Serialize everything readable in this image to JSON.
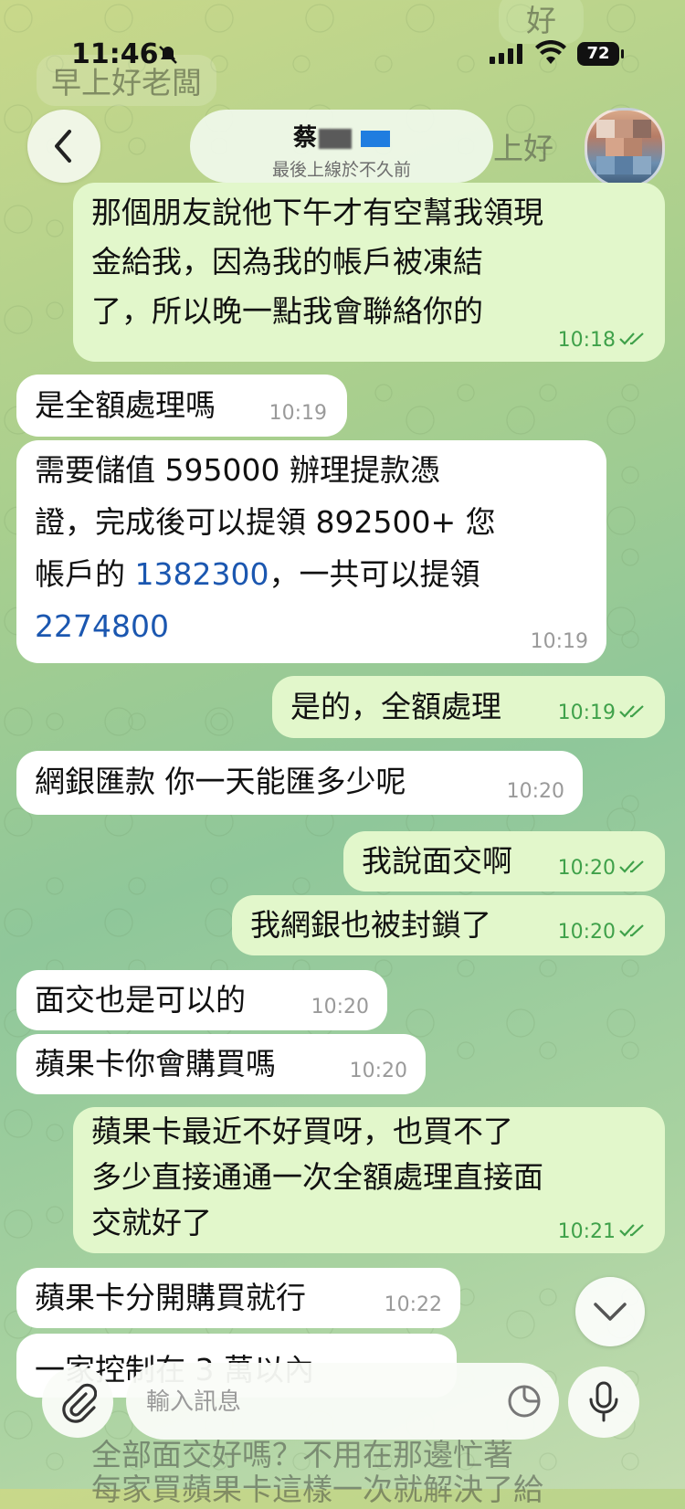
{
  "status": {
    "time": "11:46",
    "battery": "72"
  },
  "header": {
    "contact_name": "蔡",
    "status": "最後上線於不久前"
  },
  "messages": [
    {
      "dir": "out",
      "lines": "那個朋友說他下午才有空幫我領現\n金給我，因為我的帳戶被凍結\n了，所以晚一點我會聯絡你的",
      "time": "10:18"
    },
    {
      "dir": "in",
      "text": "是全額處理嗎",
      "time": "10:19"
    },
    {
      "dir": "in",
      "part1": "需要儲值 595000 辦理提款憑\n證，完成後可以提領 892500+ 您\n帳戶的 ",
      "link1": "1382300",
      "part2": "，一共可以提領\n",
      "link2": "2274800",
      "time": "10:19"
    },
    {
      "dir": "out",
      "text": "是的，全額處理",
      "time": "10:19"
    },
    {
      "dir": "in",
      "text": "網銀匯款 你一天能匯多少呢",
      "time": "10:20"
    },
    {
      "dir": "out",
      "text": "我說面交啊",
      "time": "10:20"
    },
    {
      "dir": "out",
      "text": "我網銀也被封鎖了",
      "time": "10:20"
    },
    {
      "dir": "in",
      "text": "面交也是可以的",
      "time": "10:20"
    },
    {
      "dir": "in",
      "text": "蘋果卡你會購買嗎",
      "time": "10:20"
    },
    {
      "dir": "out",
      "lines": "蘋果卡最近不好買呀，也買不了\n多少直接通通一次全額處理直接面\n交就好了",
      "time": "10:21"
    },
    {
      "dir": "in",
      "text": "蘋果卡分開購買就行",
      "time": "10:22"
    },
    {
      "dir": "in",
      "text": "一家控制在 3 萬以內",
      "time": ""
    }
  ],
  "bg_behind": {
    "top_left": "早上好老闆",
    "top_right": "好",
    "right": "上好"
  },
  "footer_faded": {
    "line1": "全部面交好嗎？不用在那邊忙著",
    "line2": "每家買蘋果卡這樣一次就解決了給"
  },
  "composer": {
    "placeholder": "輸入訊息"
  },
  "icons": {
    "back": "chevron-left-icon",
    "attach": "paperclip-icon",
    "sticker": "sticker-icon",
    "mic": "microphone-icon",
    "scroll": "chevron-down-icon"
  },
  "colors": {
    "bubble_out": "#e2f7cb",
    "bubble_in": "#ffffff",
    "link": "#1b57b0",
    "read_tick": "#3fa14a"
  }
}
